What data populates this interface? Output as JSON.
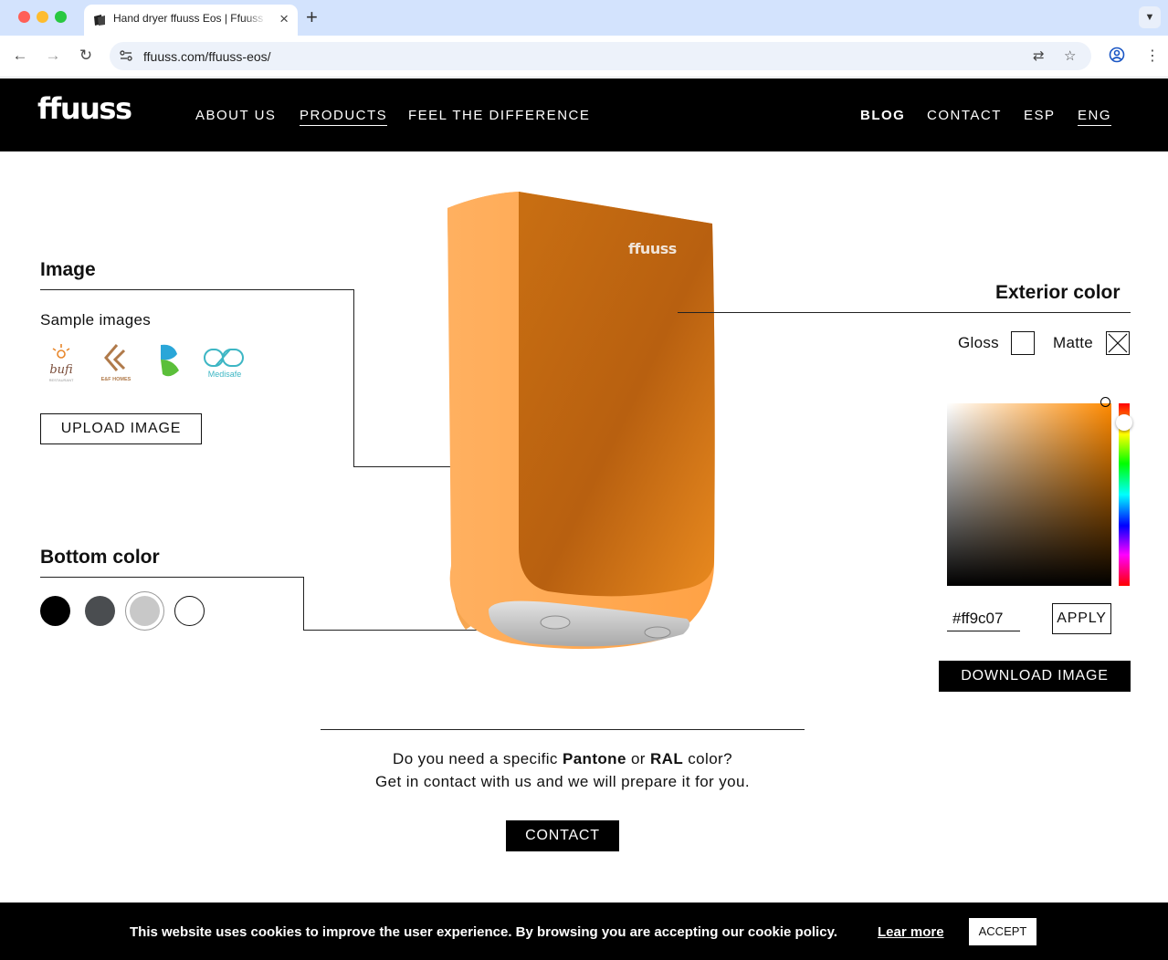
{
  "browser": {
    "tab_title": "Hand dryer ffuuss Eos | Ffuuss",
    "url": "ffuuss.com/ffuuss-eos/"
  },
  "site": {
    "logo": "ffuuss",
    "nav": {
      "about": "ABOUT US",
      "products": "PRODUCTS",
      "feel": "FEEL THE DIFFERENCE",
      "blog": "BLOG",
      "contact": "CONTACT",
      "esp": "ESP",
      "eng": "ENG"
    }
  },
  "image_panel": {
    "title": "Image",
    "sample_label": "Sample images",
    "samples": [
      "bufi",
      "E&F HOMES",
      "",
      "Medisafe"
    ],
    "upload_label": "UPLOAD IMAGE"
  },
  "bottom_panel": {
    "title": "Bottom color",
    "swatches": [
      "#000000",
      "#4a4d50",
      "#c8c8c8",
      "#ffffff"
    ]
  },
  "product": {
    "brand_mark": "ffuuss",
    "body_color": "#ff9c07"
  },
  "exterior_panel": {
    "title": "Exterior color",
    "gloss_label": "Gloss",
    "matte_label": "Matte",
    "selected_finish": "Matte",
    "hex_value": "#ff9c07",
    "apply_label": "APPLY",
    "download_label": "DOWNLOAD IMAGE"
  },
  "cta": {
    "line1_pre": "Do you need a specific ",
    "pantone": "Pantone",
    "or": " or ",
    "ral": "RAL",
    "line1_post": " color?",
    "line2": "Get in contact with us and we will prepare it for you.",
    "contact_label": "CONTACT"
  },
  "cookie": {
    "text": "This website uses cookies to improve the user experience. By browsing you are accepting our cookie policy.",
    "link": "Lear more",
    "accept": "ACCEPT"
  }
}
